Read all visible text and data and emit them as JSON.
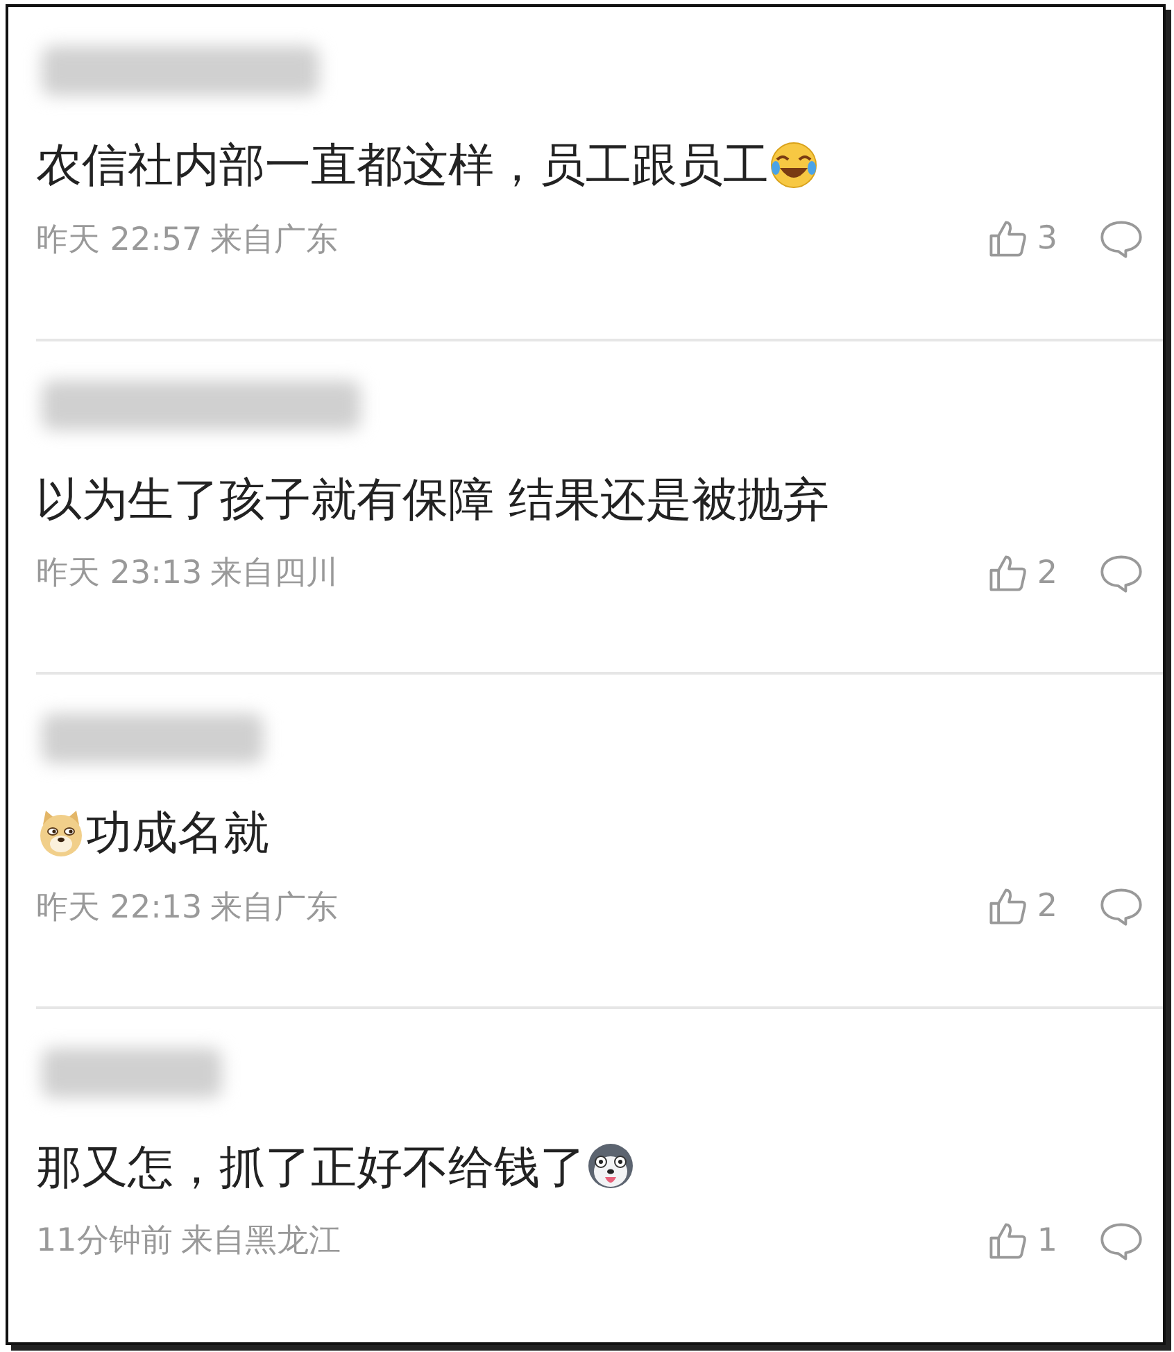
{
  "comments": [
    {
      "text": "农信社内部一直都这样，员工跟员工",
      "emoji_after": {
        "kind": "laugh-cry"
      },
      "time": "昨天 22:57",
      "location": "来自广东",
      "likes": "3"
    },
    {
      "text": "以为生了孩子就有保障 结果还是被抛弃",
      "time": "昨天 23:13",
      "location": "来自四川",
      "likes": "2"
    },
    {
      "text": "功成名就",
      "emoji_before": {
        "kind": "doge"
      },
      "time": "昨天 22:13",
      "location": "来自广东",
      "likes": "2"
    },
    {
      "text": "那又怎，抓了正好不给钱了",
      "emoji_after": {
        "kind": "husky"
      },
      "time": "11分钟前",
      "location": "来自黑龙江",
      "likes": "1"
    }
  ]
}
